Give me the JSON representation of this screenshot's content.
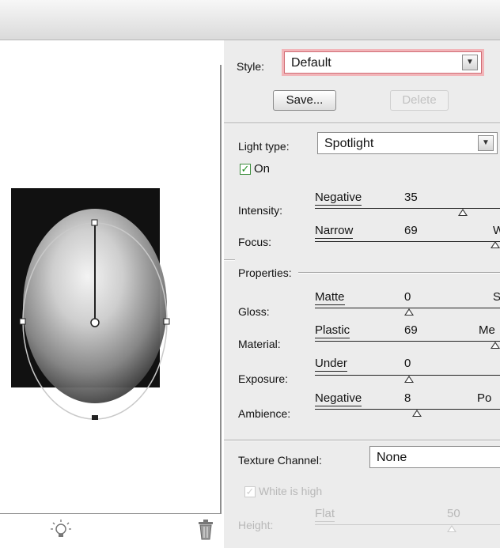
{
  "style": {
    "label": "Style:",
    "value": "Default"
  },
  "buttons": {
    "save": "Save...",
    "delete": "Delete"
  },
  "light": {
    "type_label": "Light type:",
    "type_value": "Spotlight",
    "on_label": "On"
  },
  "sliders": {
    "intensity": {
      "label": "Intensity:",
      "left": "Negative",
      "value": "35"
    },
    "focus": {
      "label": "Focus:",
      "left": "Narrow",
      "value": "69",
      "right": "W"
    },
    "gloss": {
      "label": "Gloss:",
      "left": "Matte",
      "value": "0",
      "right": "S"
    },
    "material": {
      "label": "Material:",
      "left": "Plastic",
      "value": "69",
      "right": "Me"
    },
    "exposure": {
      "label": "Exposure:",
      "left": "Under",
      "value": "0"
    },
    "ambience": {
      "label": "Ambience:",
      "left": "Negative",
      "value": "8",
      "right": "Po"
    },
    "height": {
      "label": "Height:",
      "left": "Flat",
      "value": "50"
    }
  },
  "properties": {
    "title": "Properties:"
  },
  "texture": {
    "label": "Texture Channel:",
    "value": "None",
    "white_is_high": "White is high"
  },
  "icons": {
    "light_bulb": "light-bulb-icon",
    "trash": "trash-icon"
  }
}
